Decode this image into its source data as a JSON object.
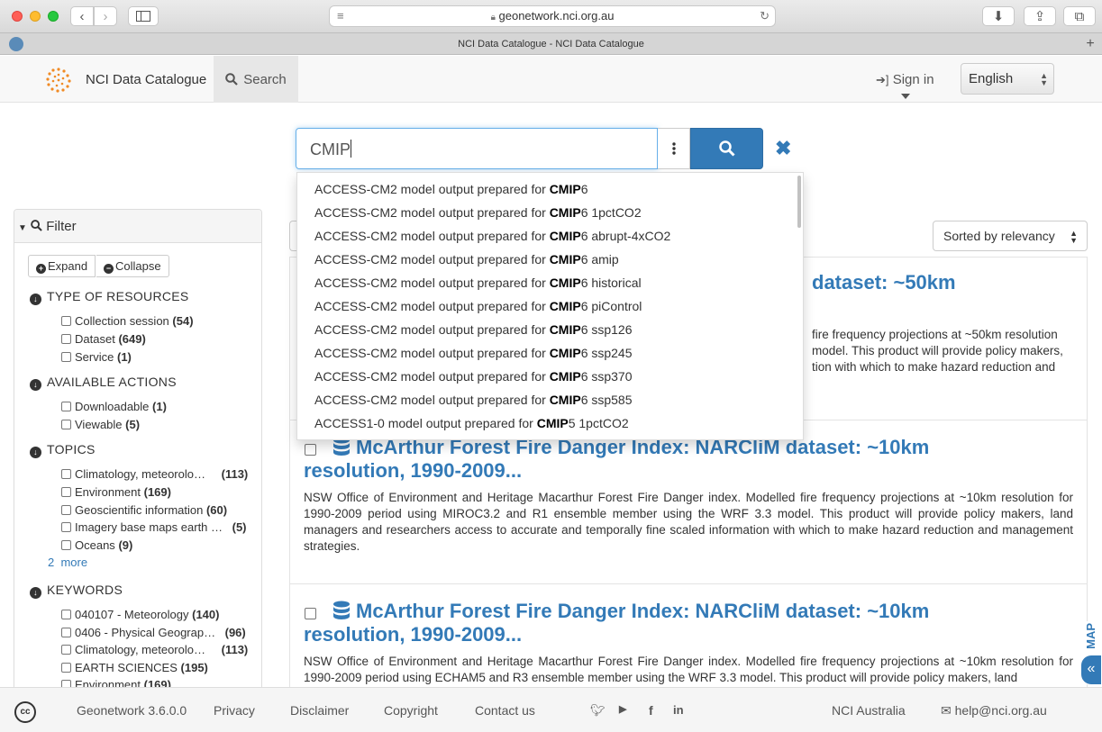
{
  "browser": {
    "url": "geonetwork.nci.org.au",
    "tab_title": "NCI Data Catalogue - NCI Data Catalogue"
  },
  "header": {
    "brand": "NCI Data Catalogue",
    "search_tab": "Search",
    "sign_in": "Sign in",
    "language": "English"
  },
  "search": {
    "value": "CMIP",
    "suggestions": [
      {
        "prefix": "ACCESS-CM2 model output prepared for ",
        "match": "CMIP",
        "suffix": "6"
      },
      {
        "prefix": "ACCESS-CM2 model output prepared for ",
        "match": "CMIP",
        "suffix": "6 1pctCO2"
      },
      {
        "prefix": "ACCESS-CM2 model output prepared for ",
        "match": "CMIP",
        "suffix": "6 abrupt-4xCO2"
      },
      {
        "prefix": "ACCESS-CM2 model output prepared for ",
        "match": "CMIP",
        "suffix": "6 amip"
      },
      {
        "prefix": "ACCESS-CM2 model output prepared for ",
        "match": "CMIP",
        "suffix": "6 historical"
      },
      {
        "prefix": "ACCESS-CM2 model output prepared for ",
        "match": "CMIP",
        "suffix": "6 piControl"
      },
      {
        "prefix": "ACCESS-CM2 model output prepared for ",
        "match": "CMIP",
        "suffix": "6 ssp126"
      },
      {
        "prefix": "ACCESS-CM2 model output prepared for ",
        "match": "CMIP",
        "suffix": "6 ssp245"
      },
      {
        "prefix": "ACCESS-CM2 model output prepared for ",
        "match": "CMIP",
        "suffix": "6 ssp370"
      },
      {
        "prefix": "ACCESS-CM2 model output prepared for ",
        "match": "CMIP",
        "suffix": "6 ssp585"
      },
      {
        "prefix": "ACCESS1-0 model output prepared for ",
        "match": "CMIP",
        "suffix": "5 1pctCO2"
      }
    ]
  },
  "filter": {
    "title": "Filter",
    "expand": "Expand",
    "collapse": "Collapse",
    "type_of_resources": {
      "title": "TYPE OF RESOURCES",
      "items": [
        {
          "label": "Collection session",
          "count": "(54)"
        },
        {
          "label": "Dataset",
          "count": "(649)"
        },
        {
          "label": "Service",
          "count": "(1)"
        }
      ]
    },
    "available_actions": {
      "title": "AVAILABLE ACTIONS",
      "items": [
        {
          "label": "Downloadable",
          "count": "(1)"
        },
        {
          "label": "Viewable",
          "count": "(5)"
        }
      ]
    },
    "topics": {
      "title": "TOPICS",
      "items": [
        {
          "label": "Climatology, meteorolo…",
          "count": "(113)"
        },
        {
          "label": "Environment",
          "count": "(169)"
        },
        {
          "label": "Geoscientific information",
          "count": "(60)"
        },
        {
          "label": "Imagery base maps earth …",
          "count": "(5)"
        },
        {
          "label": "Oceans",
          "count": "(9)"
        }
      ],
      "more_count": "2",
      "more_label": "more"
    },
    "keywords": {
      "title": "KEYWORDS",
      "items": [
        {
          "label": "040107 - Meteorology",
          "count": "(140)"
        },
        {
          "label": "0406 - Physical Geograp…",
          "count": "(96)"
        },
        {
          "label": "Climatology, meteorolo…",
          "count": "(113)"
        },
        {
          "label": "EARTH SCIENCES",
          "count": "(195)"
        },
        {
          "label": "Environment",
          "count": "(169)"
        }
      ]
    }
  },
  "results": {
    "sort": "Sorted by relevancy",
    "card1": {
      "title_partial": "dataset: ~50km",
      "desc_lines": [
        "fire frequency projections at ~50km resolution",
        "model. This product will provide policy makers,",
        "tion with which to make hazard reduction and"
      ]
    },
    "card2": {
      "title_line1": "McArthur Forest Fire Danger Index: NARCliM dataset: ~10km",
      "title_line2": "resolution, 1990-2009...",
      "desc": "NSW Office of Environment and Heritage Macarthur Forest Fire Danger index. Modelled fire frequency projections at ~10km resolution for 1990-2009 period using MIROC3.2 and R1 ensemble member using the WRF 3.3 model. This product will provide policy makers, land managers and researchers access to accurate and temporally fine scaled information with which to make hazard reduction and management strategies."
    },
    "card3": {
      "title_line1": "McArthur Forest Fire Danger Index: NARCliM dataset: ~10km",
      "title_line2": "resolution, 1990-2009...",
      "desc": "NSW Office of Environment and Heritage Macarthur Forest Fire Danger index. Modelled fire frequency projections at ~10km resolution for 1990-2009 period using ECHAM5 and R3 ensemble member using the WRF 3.3 model. This product will provide policy makers, land"
    },
    "map_label": "MAP"
  },
  "footer": {
    "version": "Geonetwork 3.6.0.0",
    "privacy": "Privacy",
    "disclaimer": "Disclaimer",
    "copyright": "Copyright",
    "contact": "Contact us",
    "org": "NCI Australia",
    "email": "help@nci.org.au"
  },
  "colors": {
    "primary": "#337ab7",
    "focus": "#66afe9"
  }
}
